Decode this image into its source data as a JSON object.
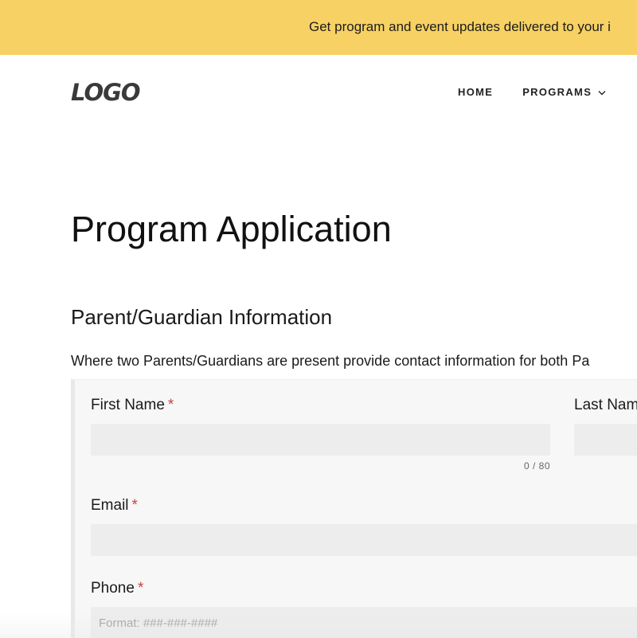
{
  "banner": {
    "text": "Get program and event updates delivered to your i"
  },
  "header": {
    "logo": "LOGO",
    "nav": [
      {
        "label": "HOME"
      },
      {
        "label": "PROGRAMS",
        "icon": "chevron-down-icon"
      }
    ]
  },
  "page": {
    "title": "Program Application",
    "section_title": "Parent/Guardian Information",
    "section_desc": "Where two Parents/Guardians are present provide contact information for both Pa"
  },
  "form": {
    "required_mark": "*",
    "first_name": {
      "label": "First Name",
      "value": "",
      "counter": "0 / 80"
    },
    "last_name": {
      "label": "Last Nam",
      "value": ""
    },
    "email": {
      "label": "Email",
      "value": ""
    },
    "phone": {
      "label": "Phone",
      "value": "",
      "placeholder": "Format: ###-###-####"
    }
  },
  "colors": {
    "banner_bg": "#f7d163",
    "required": "#c9423f",
    "panel_bg": "#f7f7f7",
    "input_bg": "#ededed"
  }
}
